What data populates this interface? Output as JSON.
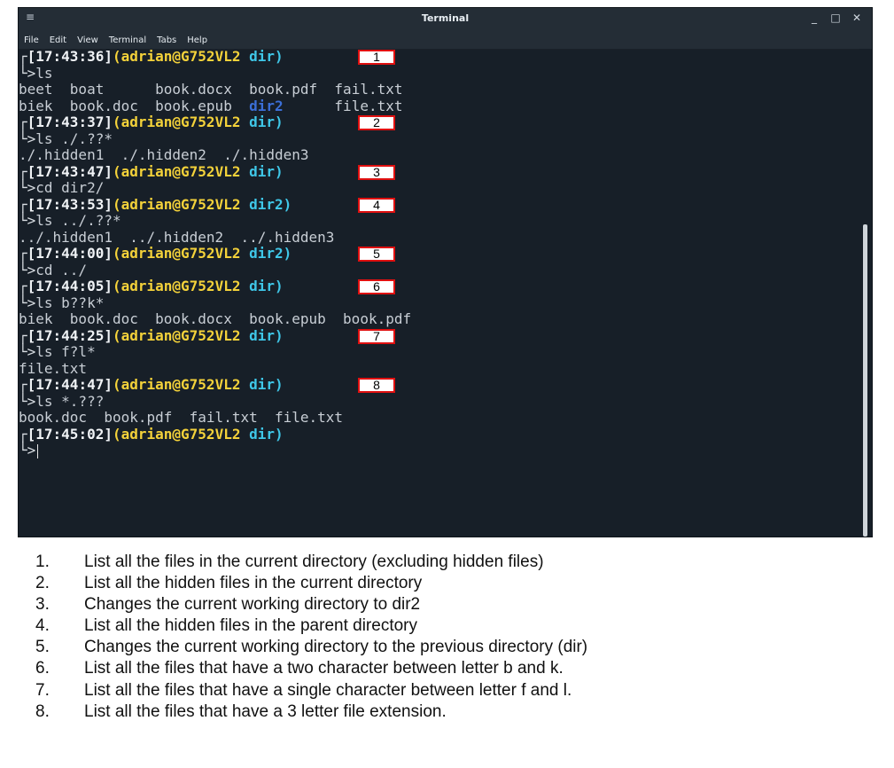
{
  "window": {
    "title": "Terminal",
    "menu": [
      "File",
      "Edit",
      "View",
      "Terminal",
      "Tabs",
      "Help"
    ],
    "controls": {
      "minimize": "_",
      "maximize": "□",
      "close": "✕"
    },
    "menu_icon": "≡"
  },
  "prompt": {
    "corner_top": "┌",
    "corner_bottom": "└>",
    "user": "(adrian@G752VL2"
  },
  "session": [
    {
      "time": "[17:43:36]",
      "dir": " dir)",
      "marker": "1",
      "command": "ls",
      "output": [
        [
          "beet",
          "boat",
          "book.docx",
          "book.pdf",
          "fail.txt"
        ],
        [
          "biek",
          "book.doc",
          "book.epub",
          "dir2",
          "file.txt"
        ]
      ]
    },
    {
      "time": "[17:43:37]",
      "dir": " dir)",
      "marker": "2",
      "command": "ls ./.??*",
      "output_text": "./.hidden1  ./.hidden2  ./.hidden3"
    },
    {
      "time": "[17:43:47]",
      "dir": " dir)",
      "marker": "3",
      "command": "cd dir2/"
    },
    {
      "time": "[17:43:53]",
      "dir": " dir2)",
      "marker": "4",
      "command": "ls ../.??*",
      "output_text": "../.hidden1  ../.hidden2  ../.hidden3"
    },
    {
      "time": "[17:44:00]",
      "dir": " dir2)",
      "marker": "5",
      "command": "cd ../"
    },
    {
      "time": "[17:44:05]",
      "dir": " dir)",
      "marker": "6",
      "command": "ls b??k*",
      "output_text": "biek  book.doc  book.docx  book.epub  book.pdf"
    },
    {
      "time": "[17:44:25]",
      "dir": " dir)",
      "marker": "7",
      "command": "ls f?l*",
      "output_text": "file.txt"
    },
    {
      "time": "[17:44:47]",
      "dir": " dir)",
      "marker": "8",
      "command": "ls *.???",
      "output_text": "book.doc  book.pdf  fail.txt  file.txt"
    },
    {
      "time": "[17:45:02]",
      "dir": " dir)",
      "marker": "",
      "command": ""
    }
  ],
  "notes": [
    {
      "num": "1.",
      "text": "List all the files in the current directory (excluding hidden files)"
    },
    {
      "num": "2.",
      "text": "List all the hidden files in the current directory"
    },
    {
      "num": "3.",
      "text": "Changes the current working directory to dir2"
    },
    {
      "num": "4.",
      "text": "List all the hidden files in the parent directory"
    },
    {
      "num": "5.",
      "text": "Changes the current working directory to the previous directory (dir)"
    },
    {
      "num": "6.",
      "text": "List all the files that have a two character between letter b and k."
    },
    {
      "num": "7.",
      "text": "List all the files that have a single character between letter f and l."
    },
    {
      "num": "8.",
      "text": "List all the files that have a 3 letter file extension."
    }
  ]
}
